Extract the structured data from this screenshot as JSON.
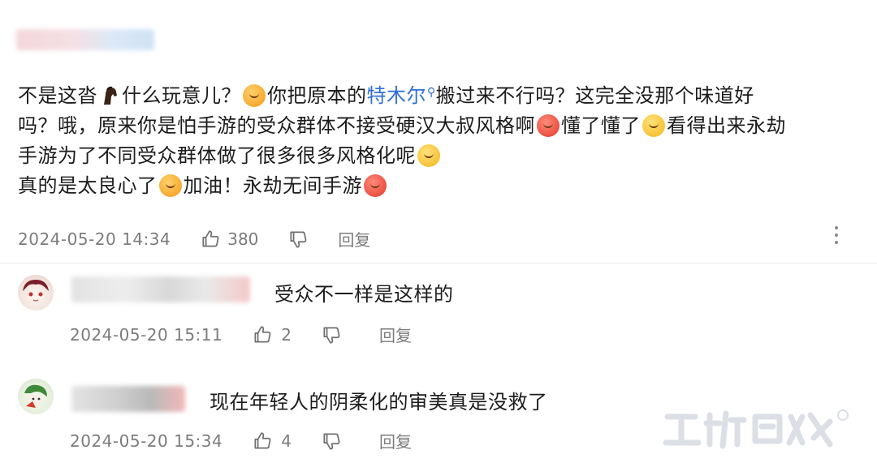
{
  "comment": {
    "line1_a": "不是这沓",
    "line1_b": "什么玩意儿？",
    "line1_c": "你把原本的",
    "link_text": "特木尔",
    "line1_d": "搬过来不行吗？这完全没那个味道好",
    "line2_a": "吗？哦，原来你是怕手游的受众群体不接受硬汉大叔风格啊",
    "line2_b": "懂了懂了",
    "line2_c": "看得出来永劫",
    "line3_a": "手游为了不同受众群体做了很多很多风格化呢",
    "line4_a": "真的是太良心了",
    "line4_b": "加油！永劫无间手游",
    "date": "2024-05-20 14:34",
    "likes": "380",
    "reply_label": "回复"
  },
  "replies": [
    {
      "text": "受众不一样是这样的",
      "date": "2024-05-20 15:11",
      "likes": "2",
      "reply_label": "回复"
    },
    {
      "text": "现在年轻人的阴柔化的审美真是没救了",
      "date": "2024-05-20 15:34",
      "likes": "4",
      "reply_label": "回复"
    }
  ],
  "icons": {
    "like": "thumbs-up-icon",
    "dislike": "thumbs-down-icon",
    "more": "more-vertical-icon",
    "search": "search-icon"
  },
  "colors": {
    "link": "#2f6fd6",
    "meta": "#7c7c7c",
    "text": "#1c1c1c"
  }
}
